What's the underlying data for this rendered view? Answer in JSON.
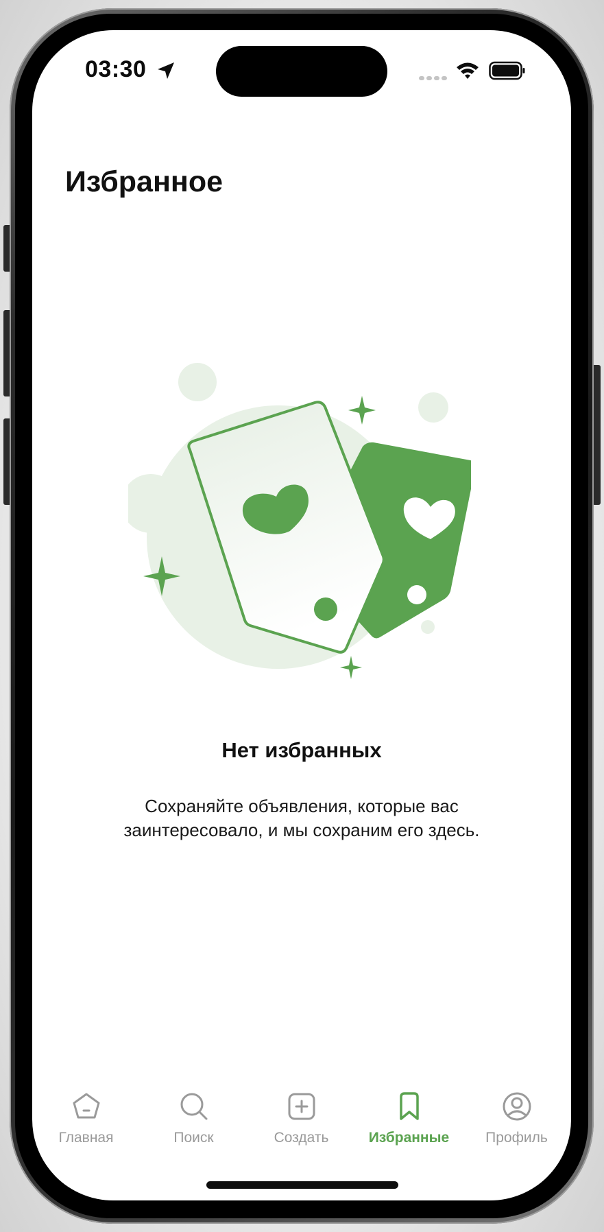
{
  "status_bar": {
    "time": "03:30"
  },
  "page": {
    "title": "Избранное"
  },
  "empty_state": {
    "title": "Нет избранных",
    "description_line1": "Сохраняйте объявления, которые вас",
    "description_line2": "заинтересовало, и мы сохраним его здесь."
  },
  "tabbar": {
    "items": [
      {
        "label": "Главная",
        "icon": "home-icon",
        "active": false
      },
      {
        "label": "Поиск",
        "icon": "search-icon",
        "active": false
      },
      {
        "label": "Создать",
        "icon": "add-icon",
        "active": false
      },
      {
        "label": "Избранные",
        "icon": "bookmark-icon",
        "active": true
      },
      {
        "label": "Профиль",
        "icon": "profile-icon",
        "active": false
      }
    ]
  },
  "colors": {
    "accent": "#5ba350",
    "inactive": "#9a9a9a",
    "illustration_bg": "#e8f1e6"
  }
}
